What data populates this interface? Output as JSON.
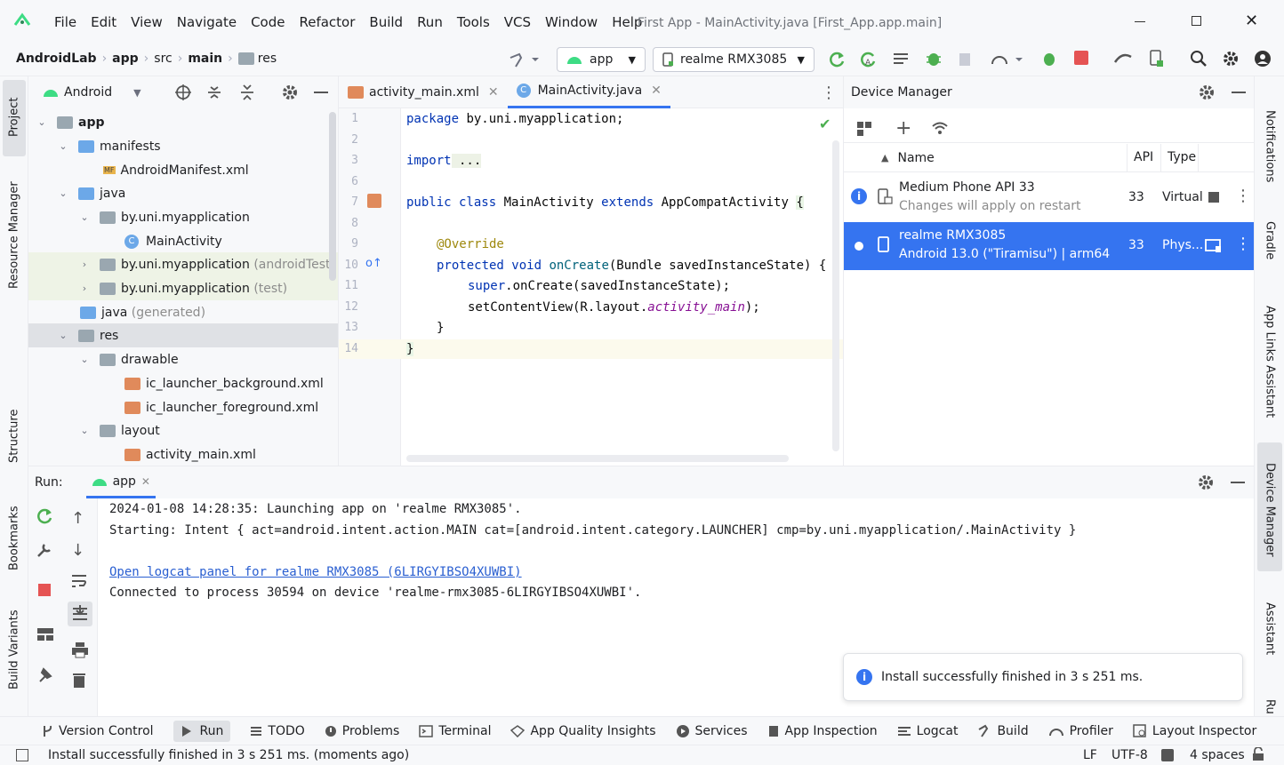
{
  "menu": [
    "File",
    "Edit",
    "View",
    "Navigate",
    "Code",
    "Refactor",
    "Build",
    "Run",
    "Tools",
    "VCS",
    "Window",
    "Help"
  ],
  "window_title": "First App - MainActivity.java [First_App.app.main]",
  "breadcrumb": [
    "AndroidLab",
    "app",
    "src",
    "main",
    "res"
  ],
  "run_config": "app",
  "device_selector": "realme RMX3085",
  "left_stripe": [
    "Project",
    "Resource Manager",
    "Structure",
    "Bookmarks",
    "Build Variants"
  ],
  "right_stripe": [
    "Notifications",
    "Gradle",
    "App Links Assistant",
    "Device Manager",
    "Assistant",
    "Ru"
  ],
  "project": {
    "view": "Android",
    "tree": [
      {
        "label": "app",
        "bold": true
      },
      {
        "label": "manifests"
      },
      {
        "label": "AndroidManifest.xml"
      },
      {
        "label": "java"
      },
      {
        "label": "by.uni.myapplication"
      },
      {
        "label": "MainActivity"
      },
      {
        "label": "by.uni.myapplication",
        "suffix": "(androidTest)"
      },
      {
        "label": "by.uni.myapplication",
        "suffix": "(test)"
      },
      {
        "label": "java",
        "suffix": "(generated)"
      },
      {
        "label": "res"
      },
      {
        "label": "drawable"
      },
      {
        "label": "ic_launcher_background.xml"
      },
      {
        "label": "ic_launcher_foreground.xml"
      },
      {
        "label": "layout"
      },
      {
        "label": "activity_main.xml"
      }
    ]
  },
  "editor": {
    "tabs": [
      "activity_main.xml",
      "MainActivity.java"
    ],
    "line_numbers": [
      "1",
      "2",
      "3",
      "6",
      "7",
      "8",
      "9",
      "10",
      "11",
      "12",
      "13",
      "14"
    ],
    "code": {
      "l1a": "package",
      "l1b": " by.uni.myapplication;",
      "l3a": "import",
      "l3b": " ...",
      "l7a": "public class",
      "l7b": " MainActivity ",
      "l7c": "extends",
      "l7d": " AppCompatActivity ",
      "l7e": "{",
      "l9": "@Override",
      "l10a": "protected void",
      "l10b": " onCreate",
      "l10c": "(Bundle savedInstanceState) {",
      "l11a": "super",
      ".l11b": "",
      "l11": ".onCreate(savedInstanceState);",
      "l12a": "setContentView(R.layout.",
      "l12b": "activity_main",
      "l12c": ");",
      "l13": "}",
      "l14": "}"
    }
  },
  "device_manager": {
    "title": "Device Manager",
    "columns": [
      "Name",
      "API",
      "Type"
    ],
    "devices": [
      {
        "name": "Medium Phone API 33",
        "sub": "Changes will apply on restart",
        "api": "33",
        "type": "Virtual"
      },
      {
        "name": "realme RMX3085",
        "sub": "Android 13.0 (\"Tiramisu\") | arm64",
        "api": "33",
        "type": "Phys..."
      }
    ]
  },
  "run": {
    "label": "Run:",
    "tab": "app",
    "console": [
      "2024-01-08 14:28:35: Launching app on 'realme RMX3085'.",
      "Starting: Intent { act=android.intent.action.MAIN cat=[android.intent.category.LAUNCHER] cmp=by.uni.myapplication/.MainActivity }",
      "Open logcat panel for realme RMX3085 (6LIRGYIBSO4XUWBI)",
      "Connected to process 30594 on device 'realme-rmx3085-6LIRGYIBSO4XUWBI'."
    ],
    "toast": "Install successfully finished in 3 s 251 ms."
  },
  "bottom_tabs": [
    "Version Control",
    "Run",
    "TODO",
    "Problems",
    "Terminal",
    "App Quality Insights",
    "Services",
    "App Inspection",
    "Logcat",
    "Build",
    "Profiler",
    "Layout Inspector"
  ],
  "status": {
    "message": "Install successfully finished in 3 s 251 ms. (moments ago)",
    "line_sep": "LF",
    "encoding": "UTF-8",
    "indent": "4 spaces"
  },
  "colors": {
    "accent": "#3574f0",
    "run_green": "#4caf50",
    "stop_red": "#e55353",
    "android_green": "#3ddc84"
  }
}
